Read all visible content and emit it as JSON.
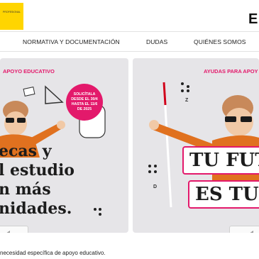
{
  "header": {
    "logo_text": "PROFESIONAL",
    "brand_letter": "E",
    "colors": {
      "brand_yellow": "#ffd500",
      "accent_pink": "#e3196b"
    }
  },
  "nav": {
    "items": [
      {
        "label": "NORMATIVA Y DOCUMENTACIÓN"
      },
      {
        "label": "DUDAS"
      },
      {
        "label": "QUIÉNES SOMOS"
      }
    ]
  },
  "card_left": {
    "eyebrow": "APOYO EDUCATIVO",
    "badge_lines": [
      "SOLICÍTALA",
      "DESDE EL 30/4",
      "HASTA EL 11/6",
      "DE 2025"
    ],
    "headline_lines": [
      "ecas y",
      "l estudio",
      "n más",
      "nidades."
    ]
  },
  "card_right": {
    "eyebrow": "AYUDAS PARA APOY",
    "braille_letters": [
      "Z",
      "D"
    ],
    "slogan_lines": [
      "TU FUT",
      "ES TU"
    ]
  },
  "footer": {
    "text": "necesidad específica de apoyo educativo."
  }
}
